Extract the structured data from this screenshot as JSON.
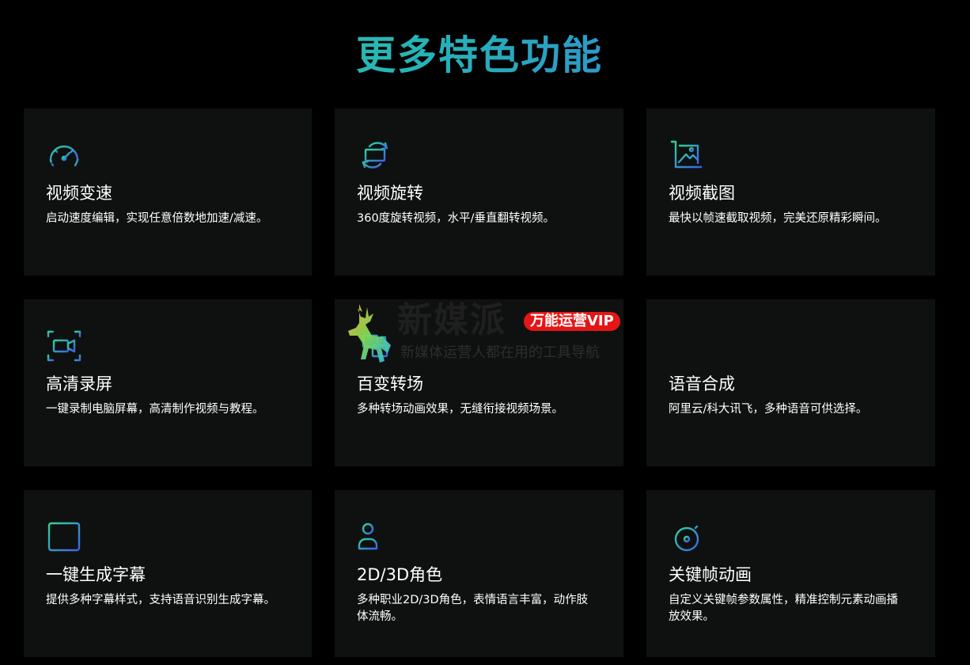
{
  "page_title": "更多特色功能",
  "colors": {
    "background": "#000000",
    "card_background": "#0f1111",
    "title_gradient_start": "#2fd39a",
    "title_gradient_end": "#3d63e8",
    "icon_green": "#2fd39a",
    "icon_blue": "#3d63e8"
  },
  "features": [
    {
      "icon": "speedometer-icon",
      "title": "视频变速",
      "desc": "启动速度编辑，实现任意倍数地加速/减速。"
    },
    {
      "icon": "rotate-icon",
      "title": "视频旋转",
      "desc": "360度旋转视频，水平/垂直翻转视频。"
    },
    {
      "icon": "crop-image-icon",
      "title": "视频截图",
      "desc": "最快以帧速截取视频，完美还原精彩瞬间。"
    },
    {
      "icon": "screen-record-icon",
      "title": "高清录屏",
      "desc": "一键录制电脑屏幕，高清制作视频与教程。"
    },
    {
      "icon": "transition-icon",
      "title": "百变转场",
      "desc": "多种转场动画效果，无缝衔接视频场景。"
    },
    {
      "icon": "voice-waveform-icon",
      "title": "语音合成",
      "desc": "阿里云/科大讯飞，多种语音可供选择。"
    },
    {
      "icon": "text-box-icon",
      "title": "一键生成字幕",
      "desc": "提供多种字幕样式，支持语音识别生成字幕。"
    },
    {
      "icon": "character-icon",
      "title": "2D/3D角色",
      "desc": "多种职业2D/3D角色，表情语言丰富，动作肢体流畅。"
    },
    {
      "icon": "stopwatch-icon",
      "title": "关键帧动画",
      "desc": "自定义关键帧参数属性，精准控制元素动画播放效果。"
    }
  ],
  "watermark": {
    "name": "新媒派",
    "badge": "万能运营VIP",
    "tagline": "新媒体运营人都在用的工具导航"
  }
}
